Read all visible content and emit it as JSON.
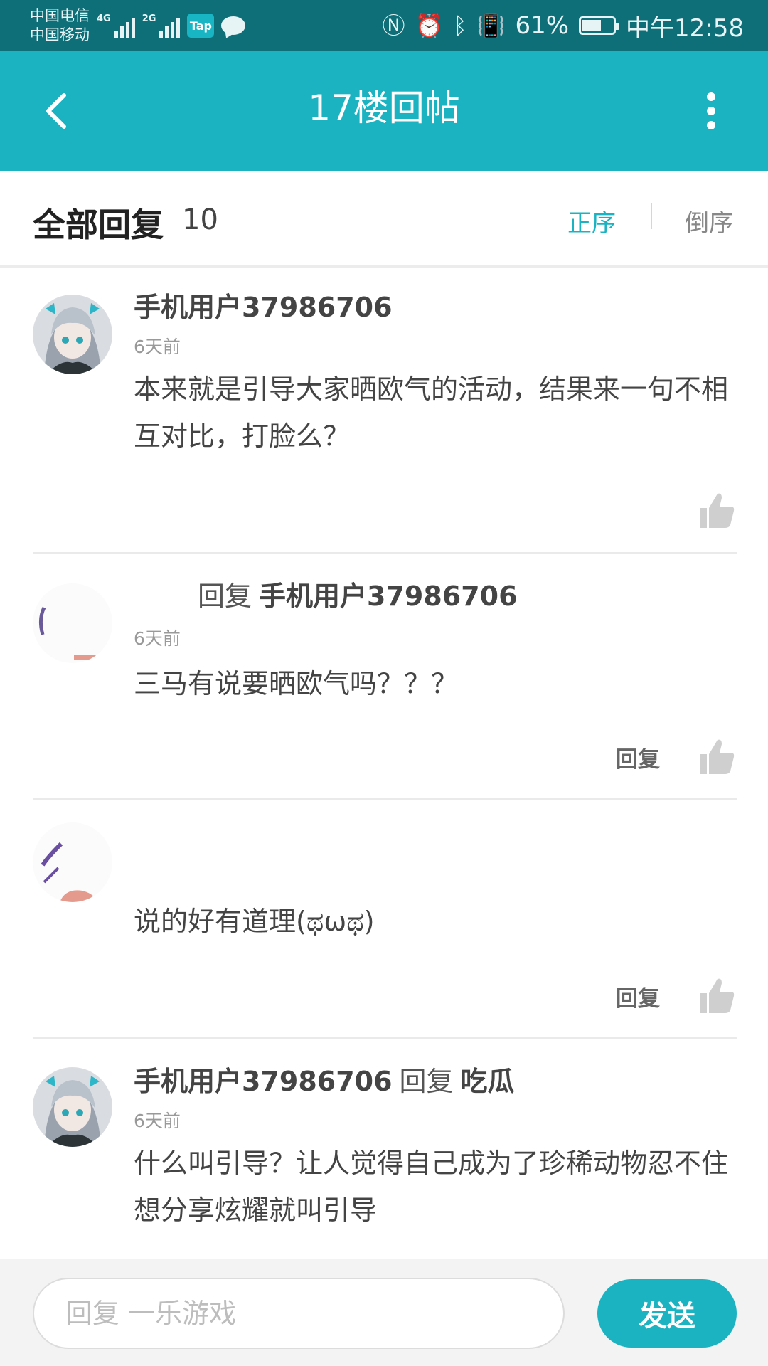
{
  "status_bar": {
    "carrier_1": "中国电信",
    "carrier_2": "中国移动",
    "net_1": "4G",
    "net_2": "2G",
    "tap_badge": "Tap",
    "battery": "61%",
    "time": "中午12:58",
    "battery_level": 0.61,
    "icons": [
      "nfc-icon",
      "alarm-icon",
      "bluetooth-icon",
      "vibrate-icon",
      "battery-icon",
      "chat-icon"
    ]
  },
  "app_bar": {
    "title": "17楼回帖"
  },
  "section": {
    "title": "全部回复",
    "count": "10",
    "sort_asc": "正序",
    "sort_desc": "倒序",
    "accent_color": "#1bb3c2"
  },
  "replies": [
    {
      "author": "手机用户37986706",
      "time": "6天前",
      "content": "本来就是引导大家晒欧气的活动，结果来一句不相互对比，打脸么？",
      "has_reply_action": false
    },
    {
      "author": "",
      "reply_word": "回复",
      "reply_to": "手机用户37986706",
      "time": "6天前",
      "content": "三马有说要晒欧气吗？？？",
      "reply_action": "回复"
    },
    {
      "author": "",
      "time": "",
      "content": "说的好有道理(ಥωಥ)",
      "reply_action": "回复"
    },
    {
      "author": "手机用户37986706",
      "reply_word": "回复",
      "reply_to": "吃瓜",
      "time": "6天前",
      "content": "什么叫引导？让人觉得自己成为了珍稀动物忍不住想分享炫耀就叫引导"
    }
  ],
  "input_bar": {
    "placeholder": "回复 一乐游戏",
    "send_label": "发送"
  }
}
